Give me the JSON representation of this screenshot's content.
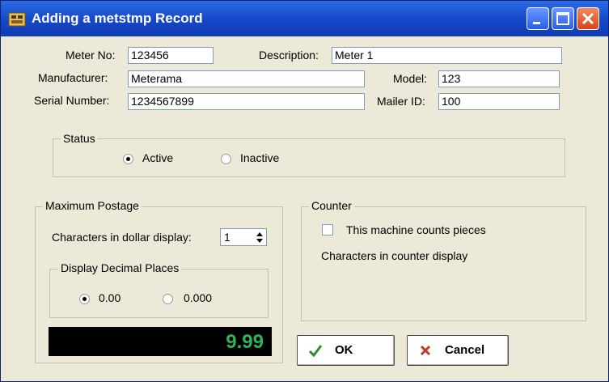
{
  "window": {
    "title": "Adding a metstmp Record"
  },
  "fields": {
    "meter_no": {
      "label": "Meter No:",
      "value": "123456"
    },
    "description": {
      "label": "Description:",
      "value": "Meter 1"
    },
    "manufacturer": {
      "label": "Manufacturer:",
      "value": "Meterama"
    },
    "model": {
      "label": "Model:",
      "value": "123"
    },
    "serial_number": {
      "label": "Serial Number:",
      "value": "1234567899"
    },
    "mailer_id": {
      "label": "Mailer ID:",
      "value": "100"
    }
  },
  "status": {
    "title": "Status",
    "options": [
      {
        "label": "Active",
        "selected": true
      },
      {
        "label": "Inactive",
        "selected": false
      }
    ]
  },
  "max_postage": {
    "title": "Maximum Postage",
    "chars_label": "Characters in dollar display:",
    "chars_value": "1",
    "decimal_group_title": "Display Decimal Places",
    "decimal_options": [
      {
        "label": "0.00",
        "selected": true
      },
      {
        "label": "0.000",
        "selected": false
      }
    ],
    "display_value": "9.99"
  },
  "counter": {
    "title": "Counter",
    "checkbox_label": "This machine counts pieces",
    "checked": false,
    "chars_label": "Characters in counter display"
  },
  "buttons": {
    "ok": "OK",
    "cancel": "Cancel"
  },
  "colors": {
    "titlebar": "#1547c8",
    "display_text": "#2fb45a",
    "ok_icon": "#2e8b2e",
    "cancel_icon": "#c0392b"
  },
  "icons": {
    "window": "meter-app-icon",
    "ok": "checkmark-icon",
    "cancel": "x-icon"
  }
}
